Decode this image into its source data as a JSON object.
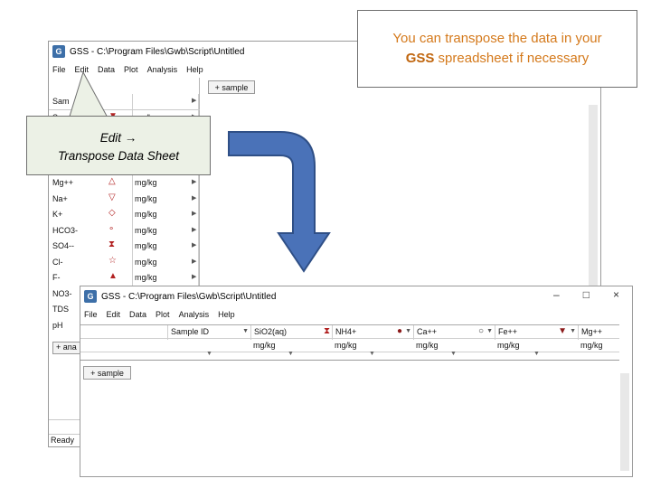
{
  "window1": {
    "title": "GSS - C:\\Program Files\\Gwb\\Script\\Untitled",
    "icon": "gss-app-icon",
    "menu": [
      "File",
      "Edit",
      "Data",
      "Plot",
      "Analysis",
      "Help"
    ],
    "sample_button": "+ sample",
    "header_label": "Sam",
    "rows": [
      {
        "name": "S",
        "symbol": "▼",
        "unit": "mg/kg"
      },
      {
        "name": "Mg++",
        "symbol": "△",
        "unit": "mg/kg"
      },
      {
        "name": "Na+",
        "symbol": "▽",
        "unit": "mg/kg"
      },
      {
        "name": "K+",
        "symbol": "◇",
        "unit": "mg/kg"
      },
      {
        "name": "HCO3-",
        "symbol": "∘",
        "unit": "mg/kg"
      },
      {
        "name": "SO4--",
        "symbol": "⧗",
        "unit": "mg/kg"
      },
      {
        "name": "Cl-",
        "symbol": "☆",
        "unit": "mg/kg"
      },
      {
        "name": "F-",
        "symbol": "▲",
        "unit": "mg/kg"
      },
      {
        "name": "NO3-",
        "symbol": "",
        "unit": ""
      },
      {
        "name": "TDS",
        "symbol": "",
        "unit": ""
      },
      {
        "name": "pH",
        "symbol": "",
        "unit": ""
      }
    ],
    "add_button": "+ ana",
    "status": "Ready"
  },
  "window2": {
    "title": "GSS - C:\\Program Files\\Gwb\\Script\\Untitled",
    "controls": {
      "minimize": "–",
      "maximize": "□",
      "close": "×"
    },
    "menu": [
      "File",
      "Edit",
      "Data",
      "Plot",
      "Analysis",
      "Help"
    ],
    "columns": [
      {
        "label": "Sample ID",
        "symbol": "",
        "unit": ""
      },
      {
        "label": "SiO2(aq)",
        "symbol": "⧗",
        "unit": "mg/kg"
      },
      {
        "label": "NH4+",
        "symbol": "●",
        "unit": "mg/kg"
      },
      {
        "label": "Ca++",
        "symbol": "○",
        "unit": "mg/kg"
      },
      {
        "label": "Fe++",
        "symbol": "▼",
        "unit": "mg/kg"
      },
      {
        "label": "Mg++",
        "symbol": "",
        "unit": "mg/kg"
      }
    ],
    "sample_button": "+ sample"
  },
  "callout_top": {
    "line1": "You can transpose the data in your",
    "brand": "GSS",
    "line2_rest": " spreadsheet if necessary"
  },
  "callout_left": {
    "line1": "Edit →",
    "line2": "Transpose Data Sheet"
  },
  "colors": {
    "callout_text": "#d4791b",
    "callout_left_bg": "#ecf1e6",
    "arrow_fill": "#4a72b8",
    "arrow_stroke": "#2f4f86"
  }
}
